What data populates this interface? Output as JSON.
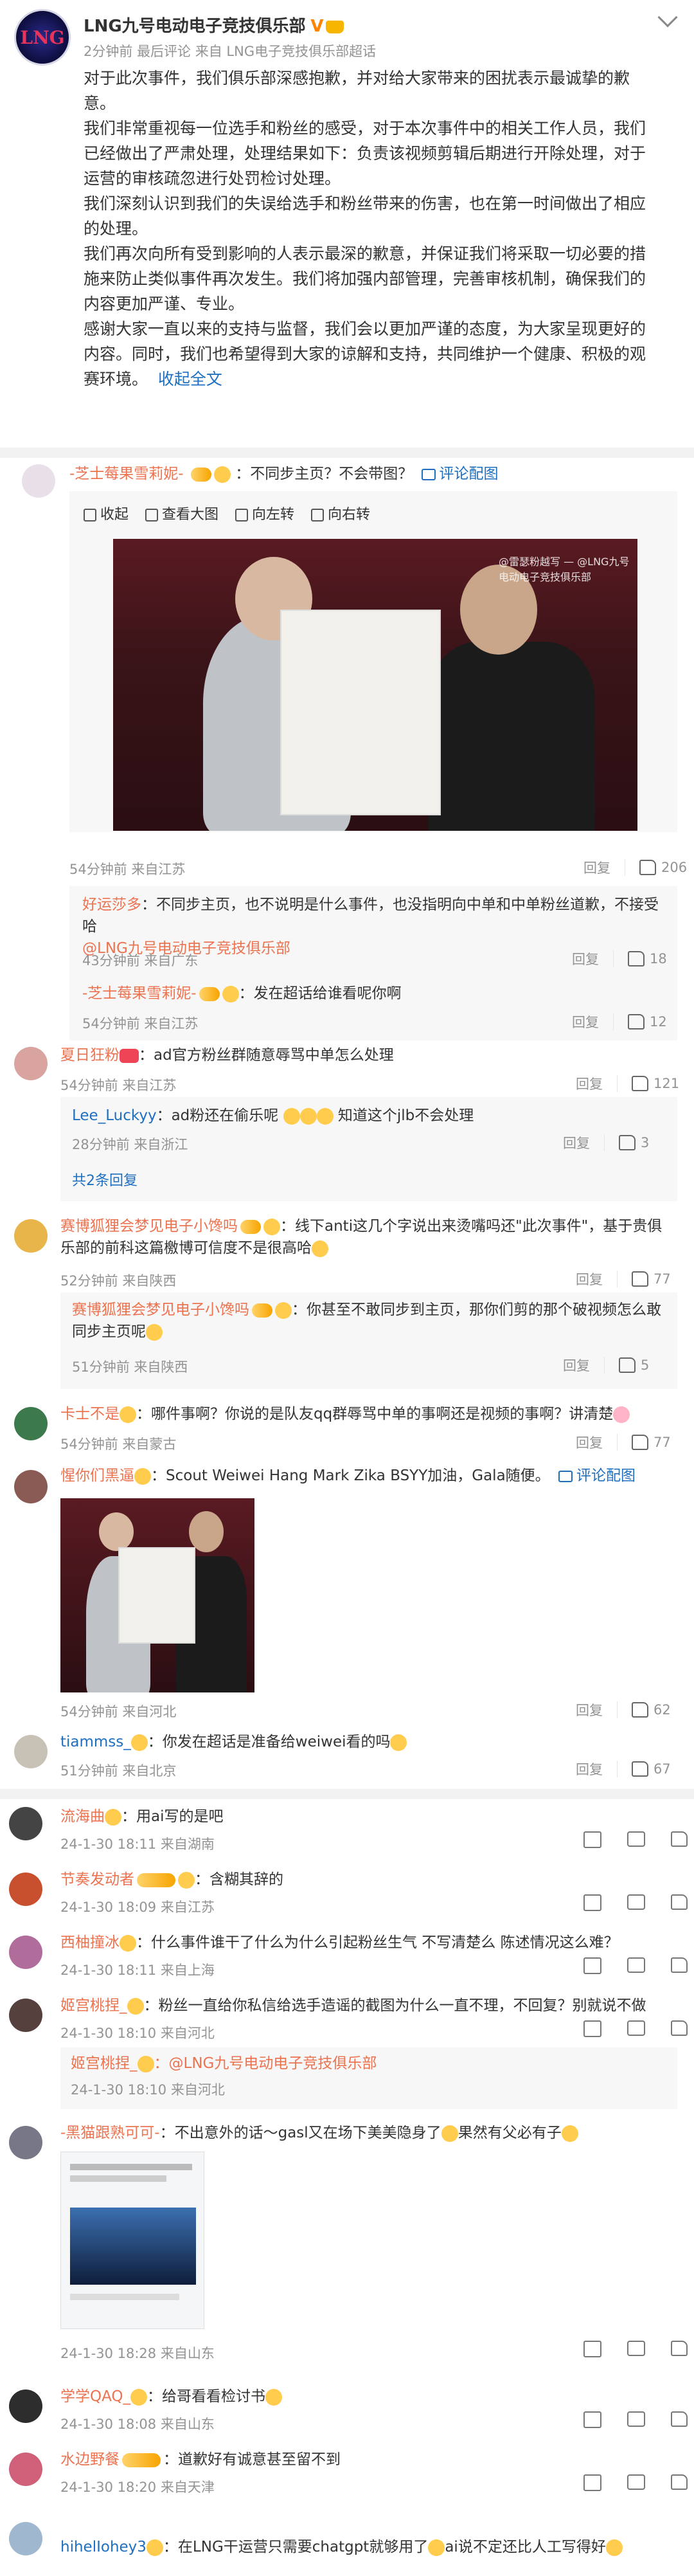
{
  "post": {
    "author": "LNG九号电动电子竞技俱乐部",
    "time": "2分钟前",
    "edited": "最后评论",
    "source": "来自 LNG电子竞技俱乐部超话",
    "body_lines": [
      "对于此次事件，我们俱乐部深感抱歉，并对给大家带来的困扰表示最诚挚的歉",
      "意。",
      "我们非常重视每一位选手和粉丝的感受，对于本次事件中的相关工作人员，我们",
      "已经做出了严肃处理，处理结果如下：负责该视频剪辑后期进行开除处理，对于",
      "运营的审核疏忽进行处罚检讨处理。",
      "我们深刻认识到我们的失误给选手和粉丝带来的伤害，也在第一时间做出了相应",
      "的处理。",
      "我们再次向所有受到影响的人表示最深的歉意，并保证我们将采取一切必要的措",
      "施来防止类似事件再次发生。我们将加强内部管理，完善审核机制，确保我们的",
      "内容更加严谨、专业。",
      "感谢大家一直以来的支持与监督，我们会以更加严谨的态度，为大家呈现更好的",
      "内容。同时，我们也希望得到大家的谅解和支持，共同维护一个健康、积极的观",
      "赛环境。"
    ],
    "collapse": "收起全文"
  },
  "toolbar": {
    "collapse": "收起",
    "view_large": "查看大图",
    "rotate_left": "向左转",
    "rotate_right": "向右转"
  },
  "watermark": "@雷瑟粉越写 — @LNG九号电动电子竞技俱乐部",
  "comments": [
    {
      "user": "-芝士莓果雪莉妮-",
      "text": "：不同步主页？不会带图？",
      "review_link": "评论配图",
      "time": "54分钟前 来自江苏",
      "reply": "回复",
      "likes": "206",
      "subs": [
        {
          "user": "好运莎多",
          "text": "：不同步主页，也不说明是什么事件，也没指明向中单和中单粉丝道歉，不接受哈",
          "mention": "@LNG九号电动电子竞技俱乐部",
          "time": "43分钟前 来自广东",
          "reply": "回复",
          "likes": "18"
        },
        {
          "user": "-芝士莓果雪莉妮-",
          "text": "：发在超话给谁看呢你啊",
          "time": "54分钟前 来自江苏",
          "reply": "回复",
          "likes": "12"
        }
      ]
    },
    {
      "user": "夏日狂粉",
      "text": "：ad官方粉丝群随意辱骂中单怎么处理",
      "time": "54分钟前 来自江苏",
      "reply": "回复",
      "likes": "121",
      "subs": [
        {
          "user": "Lee_Luckyy",
          "text": "：ad粉还在偷乐呢",
          "text2": "知道这个jlb不会处理",
          "time": "28分钟前 来自浙江",
          "reply": "回复",
          "likes": "3"
        }
      ],
      "more_replies": "共2条回复"
    },
    {
      "user": "赛博狐狸会梦见电子小馋吗",
      "text": "：线下anti这几个字说出来烫嘴吗还\"此次事件\"，基于贵俱乐部的前科这篇檄博可信度不是很高哈",
      "time": "52分钟前 来自陕西",
      "reply": "回复",
      "likes": "77",
      "subs": [
        {
          "user": "赛博狐狸会梦见电子小馋吗",
          "text": "：你甚至不敢同步到主页，那你们剪的那个破视频怎么敢同步主页呢",
          "time": "51分钟前 来自陕西",
          "reply": "回复",
          "likes": "5"
        }
      ]
    },
    {
      "user": "卡士不是",
      "text": "：哪件事啊？你说的是队友qq群辱骂中单的事啊还是视频的事啊？讲清楚",
      "time": "54分钟前 来自蒙古",
      "reply": "回复",
      "likes": "77"
    },
    {
      "user": "惺你们黑逼",
      "text": "：Scout Weiwei Hang Mark Zika BSYY加油，Gala随便。",
      "review_link": "评论配图",
      "time": "54分钟前 来自河北",
      "reply": "回复",
      "likes": "62"
    },
    {
      "user": "tiammss_",
      "text": "：你发在超话是准备给weiwei看的吗",
      "time": "51分钟前 来自北京",
      "reply": "回复",
      "likes": "67"
    }
  ],
  "plain_comments": [
    {
      "user": "流海曲",
      "text": "：用ai写的是吧",
      "time": "24-1-30 18:11 来自湖南"
    },
    {
      "user": "节奏发动者",
      "text": "：含糊其辞的",
      "time": "24-1-30 18:09 来自江苏"
    },
    {
      "user": "西柚撞冰",
      "text": "：什么事件谁干了什么为什么引起粉丝生气 不写清楚么 陈述情况这么难？",
      "time": "24-1-30 18:11 来自上海"
    },
    {
      "user": "姬宫桃捏_",
      "text": "：粉丝一直给你私信给选手造谣的截图为什么一直不理，不回复？别就说不做",
      "time": "24-1-30 18:10 来自河北",
      "sub_user": "姬宫桃捏_",
      "sub_text": "：@LNG九号电动电子竞技俱乐部",
      "sub_time": "24-1-30 18:10 来自河北"
    },
    {
      "user": "-黑猫跟熟可可-",
      "text": "：不出意外的话～gasl又在场下美美隐身了",
      "text2": "果然有父必有子",
      "time": "24-1-30 18:28 来自山东"
    },
    {
      "user": "学学QAQ_",
      "text": "：给哥看看检讨书",
      "time": "24-1-30 18:08 来自山东"
    },
    {
      "user": "水边野餐",
      "text": "：道歉好有诚意甚至留不到",
      "time": "24-1-30 18:20 来自天津"
    },
    {
      "user": "hihelIohey3",
      "text": "：在LNG干运营只需要chatgpt就够用了",
      "text2": "ai说不定还比人工写得好",
      "time": ""
    }
  ]
}
